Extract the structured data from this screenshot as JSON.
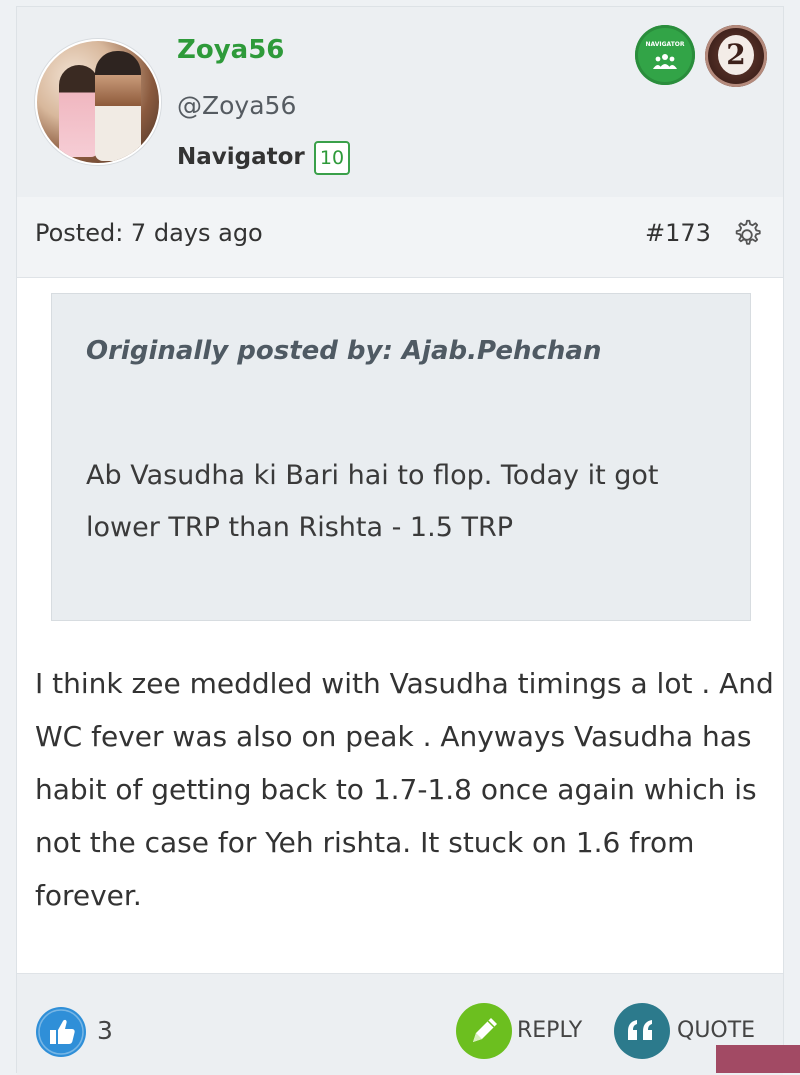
{
  "user": {
    "username": "Zoya56",
    "handle": "@Zoya56",
    "rank": "Navigator",
    "level": "10",
    "badges": [
      {
        "name": "navigator-badge",
        "label": "NAVIGATOR",
        "color": "#32a447"
      },
      {
        "name": "level-2-badge",
        "label": "2",
        "color": "#3d201a"
      }
    ]
  },
  "post": {
    "posted": "Posted: 7 days ago",
    "number": "#173"
  },
  "quote": {
    "author": "Originally posted by: Ajab.Pehchan",
    "text": "Ab Vasudha ki Bari hai to flop. Today it got lower TRP than Rishta - 1.5 TRP"
  },
  "body": {
    "text": "I think zee meddled with Vasudha timings a lot . And WC fever was also on peak . Anyways Vasudha has habit of getting back to 1.7-1.8 once again which is not the case for Yeh rishta. It stuck on 1.6 from forever."
  },
  "actions": {
    "like_count": "3",
    "reply_label": "REPLY",
    "quote_label": "QUOTE"
  },
  "colors": {
    "username": "#2e9a3a",
    "like": "#2f8fd8",
    "reply": "#6cbf1f",
    "quote": "#2c7a8c"
  }
}
